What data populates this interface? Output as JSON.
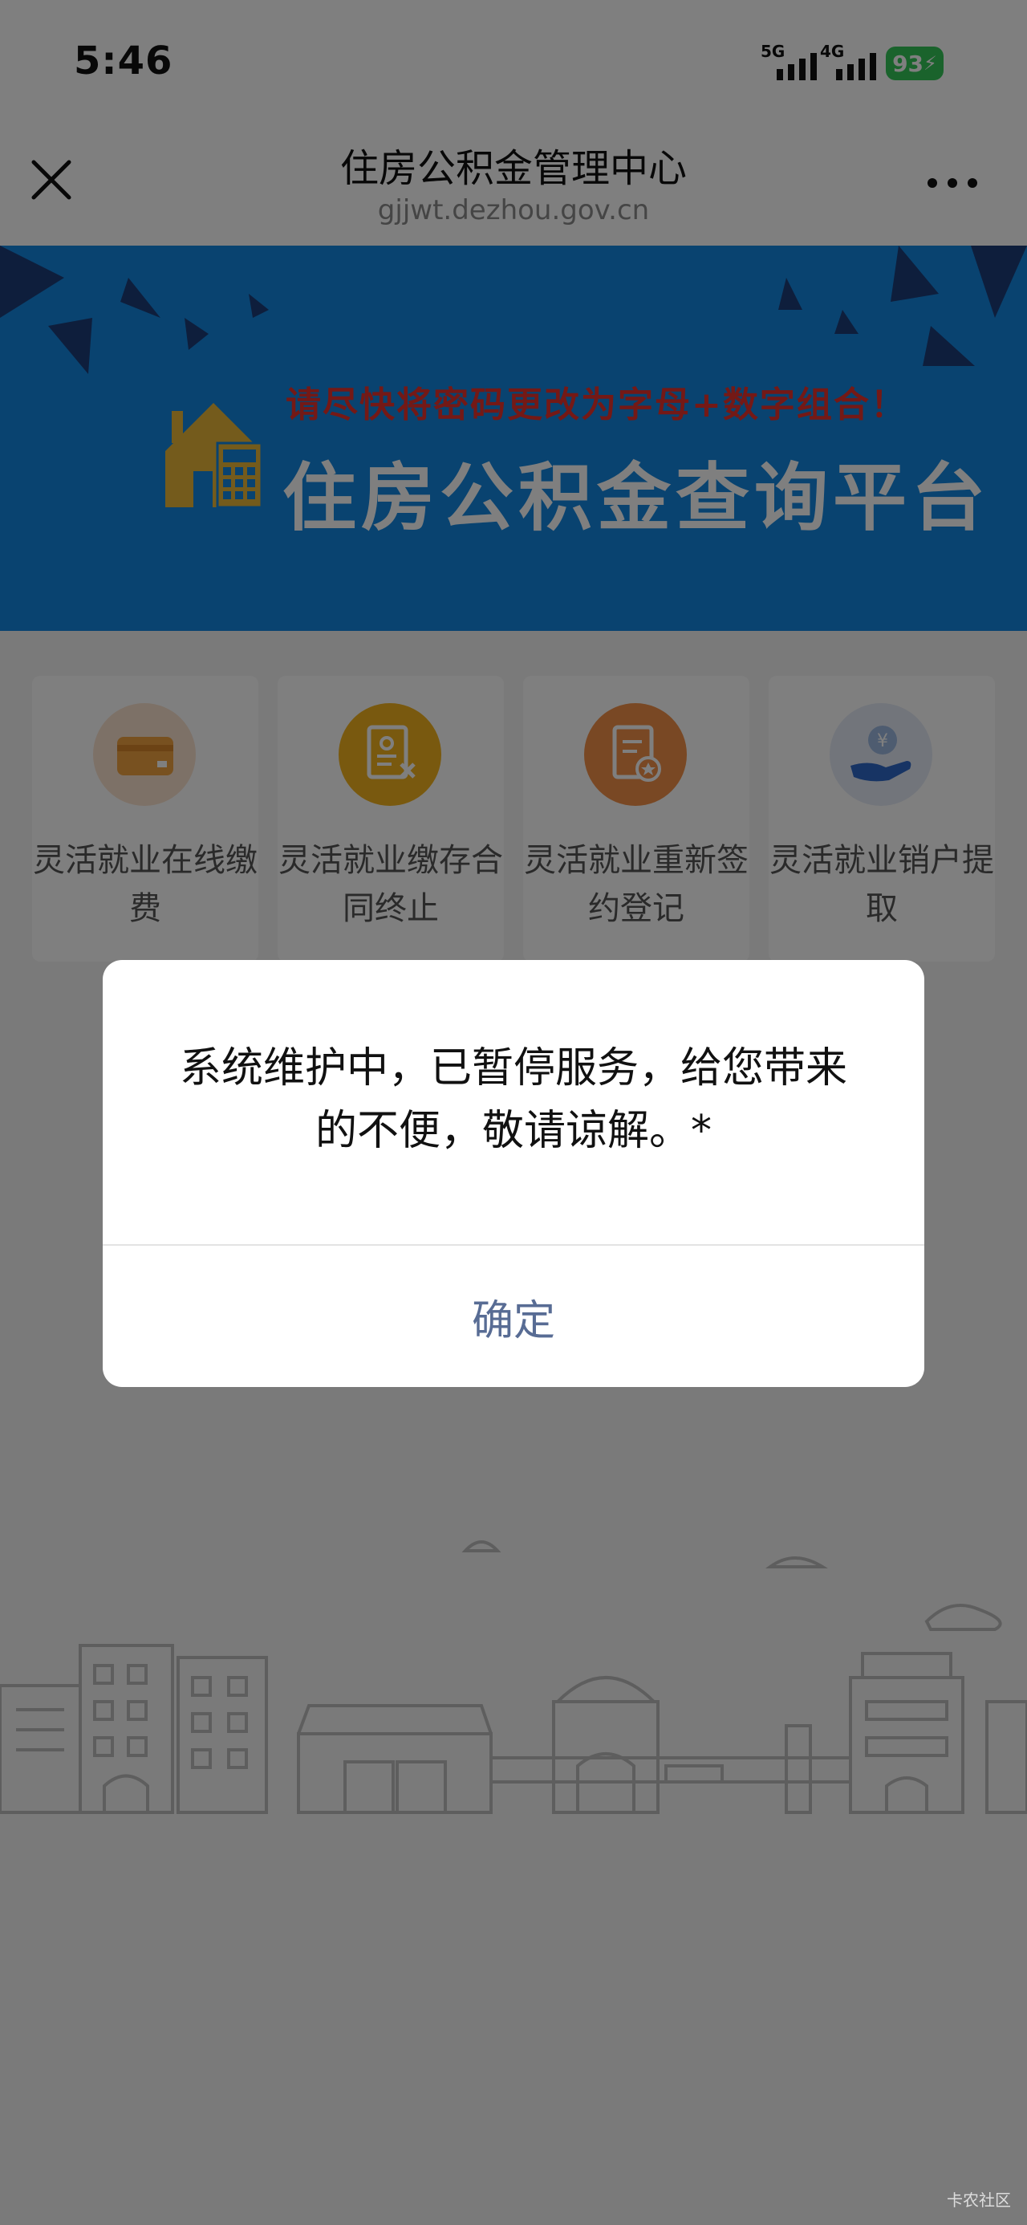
{
  "status_bar": {
    "time": "5:46",
    "network_1": "5G",
    "network_2": "4G",
    "battery": "93"
  },
  "header": {
    "title": "住房公积金管理中心",
    "url": "gjjwt.dezhou.gov.cn",
    "close_icon": "close-icon",
    "more_icon": "more-icon"
  },
  "banner": {
    "warning": "请尽快将密码更改为字母+数字组合！",
    "title": "住房公积金查询平台"
  },
  "services": [
    {
      "label": "灵活就业在线缴费",
      "icon": "card-icon",
      "color": "#fbe3cf"
    },
    {
      "label": "灵活就业缴存合同终止",
      "icon": "contract-icon",
      "color": "#f2b31f"
    },
    {
      "label": "灵活就业重新签约登记",
      "icon": "sign-icon",
      "color": "#f29148"
    },
    {
      "label": "灵活就业销户提取",
      "icon": "withdraw-icon",
      "color": "#e4ebf7"
    }
  ],
  "dialog": {
    "message": "系统维护中，已暂停服务，给您带来的不便，敬请谅解。*",
    "confirm": "确定"
  },
  "watermark": "卡农社区",
  "colors": {
    "banner_blue": "#1287e0",
    "warning_red": "#e8322d",
    "confirm_text": "#586c94",
    "battery_green": "#34c759"
  }
}
